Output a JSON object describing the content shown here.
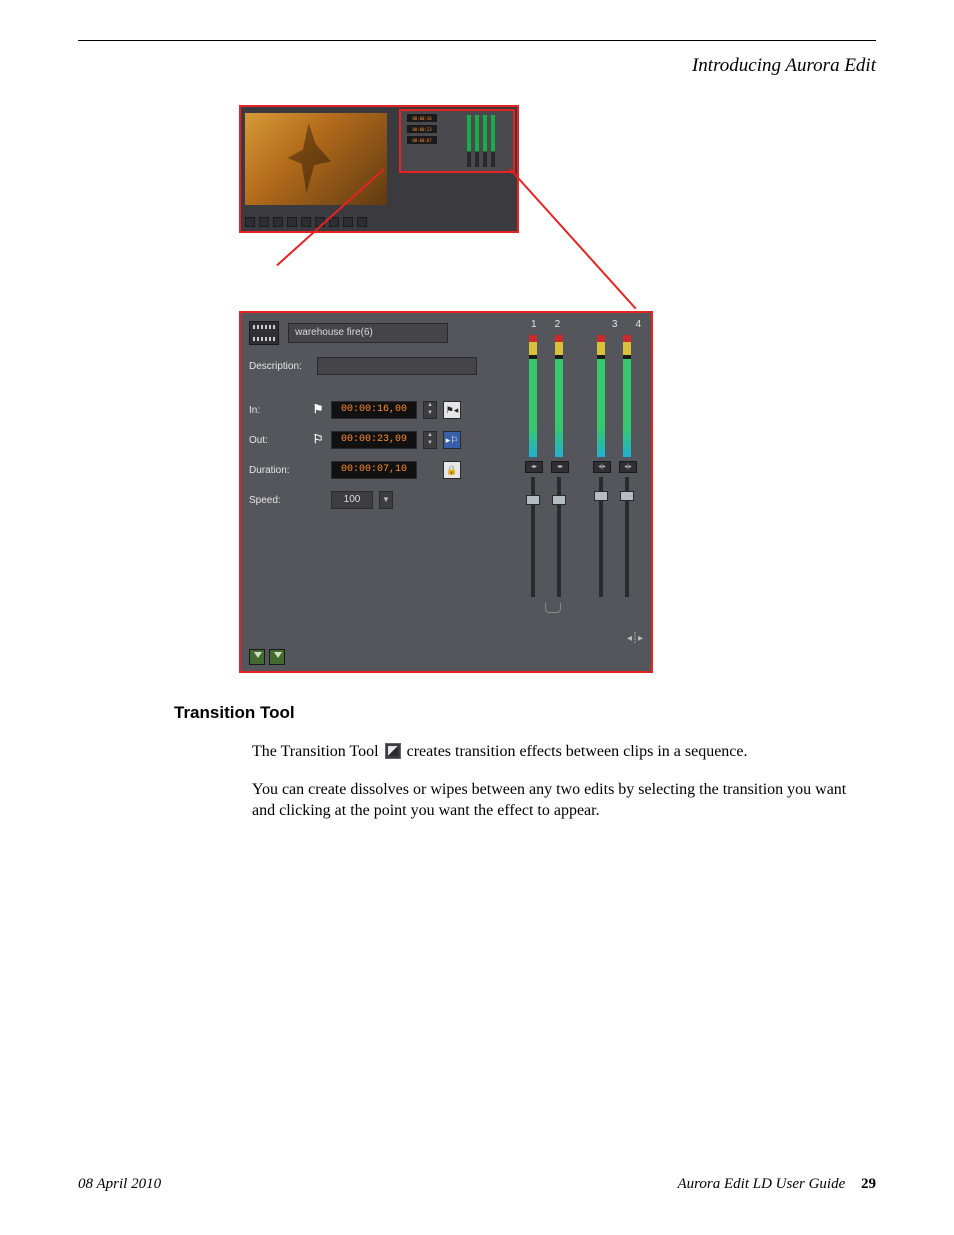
{
  "chapter_title": "Introducing Aurora Edit",
  "panel": {
    "clip_name": "warehouse fire(6)",
    "labels": {
      "description": "Description:",
      "in": "In:",
      "out": "Out:",
      "duration": "Duration:",
      "speed": "Speed:"
    },
    "in_time": "00:00:16,00",
    "out_time": "00:00:23,09",
    "duration_time": "00:00:07,10",
    "speed_value": "100",
    "channels": [
      "1",
      "2",
      "3",
      "4"
    ]
  },
  "section_title": "Transition Tool",
  "body": {
    "p1a": "The Transition Tool ",
    "p1b": " creates transition effects between clips in a sequence.",
    "p2": "You can create dissolves or wipes between any two edits by selecting the transition you want and clicking at the point you want the effect to appear."
  },
  "footer": {
    "date": "08 April 2010",
    "guide": "Aurora Edit LD User Guide",
    "page": "29"
  }
}
